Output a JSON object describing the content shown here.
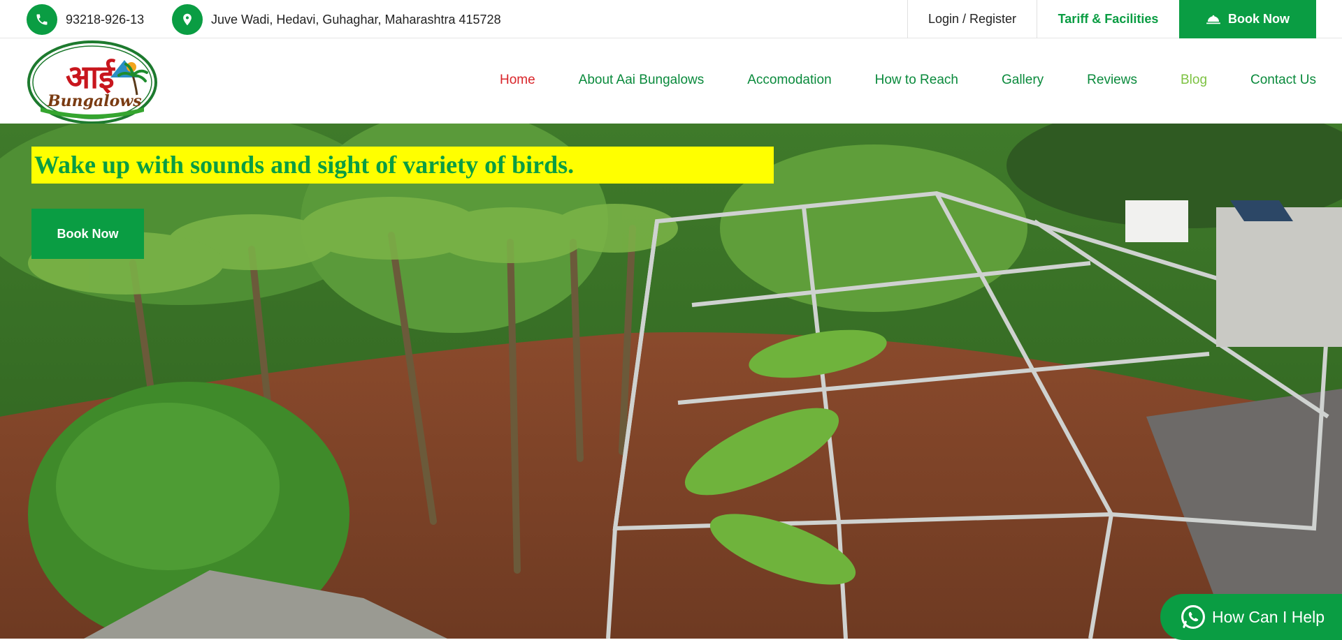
{
  "topbar": {
    "phone": "93218-926-13",
    "address": "Juve Wadi, Hedavi, Guhaghar, Maharashtra 415728",
    "login_label": "Login / Register",
    "tariff_label": "Tariff & Facilities",
    "book_label": "Book Now"
  },
  "logo": {
    "text_marathi": "आई",
    "text_english": "Bungalows"
  },
  "nav": {
    "items": [
      {
        "label": "Home"
      },
      {
        "label": "About Aai Bungalows"
      },
      {
        "label": "Accomodation"
      },
      {
        "label": "How to Reach"
      },
      {
        "label": "Gallery"
      },
      {
        "label": "Reviews"
      },
      {
        "label": "Blog"
      },
      {
        "label": "Contact Us"
      }
    ],
    "active_index": 0
  },
  "hero": {
    "title": "Wake up with sounds and sight of variety of birds.",
    "button_label": "Book Now"
  },
  "whatsapp": {
    "label": "How Can I Help"
  },
  "colors": {
    "brand_green": "#0a9d43",
    "nav_green": "#0a8a3c",
    "active_red": "#d9252a",
    "blog_green": "#7dc242",
    "highlight_yellow": "#ffff00"
  },
  "icons": {
    "phone": "phone-icon",
    "location": "map-pin-icon",
    "booking": "bell-icon",
    "whatsapp": "whatsapp-icon"
  }
}
